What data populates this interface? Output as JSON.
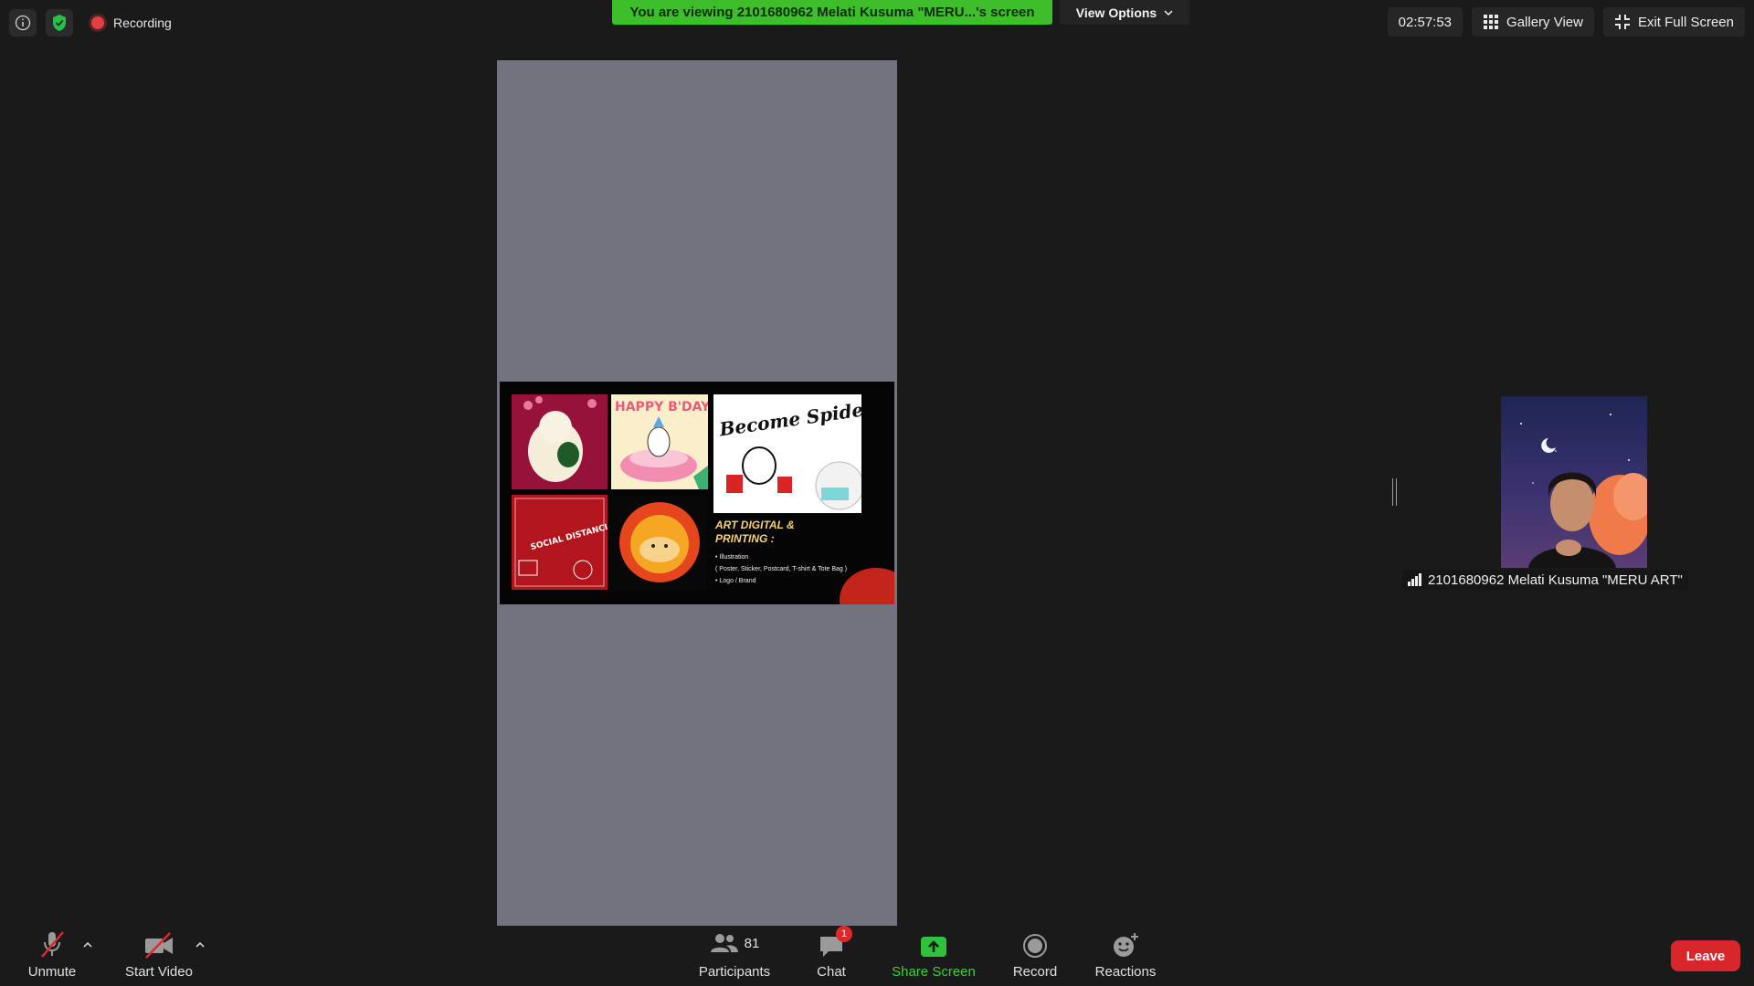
{
  "top_left": {
    "recording_label": "Recording"
  },
  "banner": {
    "viewing_text": "You are viewing 2101680962 Melati Kusuma \"MERU...'s screen"
  },
  "view_options": {
    "label": "View Options"
  },
  "top_right": {
    "timer": "02:57:53",
    "gallery_label": "Gallery View",
    "exit_full_label": "Exit Full Screen"
  },
  "shared_screen": {
    "tiles": [
      {
        "caption": ""
      },
      {
        "caption": "HAPPY B'DAY"
      },
      {
        "caption": "Become Spider."
      },
      {
        "caption": "SOCIAL DISTANCING"
      },
      {
        "caption": ""
      }
    ],
    "heading_line1": "ART DIGITAL &",
    "heading_line2": "PRINTING :",
    "bullets": [
      "• Illustration",
      "( Poster, Sticker, Postcard, T-shirt & Tote Bag )",
      "• Logo / Brand"
    ]
  },
  "participant": {
    "name": "2101680962 Melati Kusuma \"MERU ART\""
  },
  "toolbar": {
    "unmute_label": "Unmute",
    "start_video_label": "Start Video",
    "participants_label": "Participants",
    "participants_count": "81",
    "chat_label": "Chat",
    "chat_badge": "1",
    "share_label": "Share Screen",
    "record_label": "Record",
    "reactions_label": "Reactions",
    "leave_label": "Leave"
  },
  "colors": {
    "share_green": "#3dbe2b",
    "leave_red": "#d9262b",
    "record_red": "#e53e3e"
  }
}
